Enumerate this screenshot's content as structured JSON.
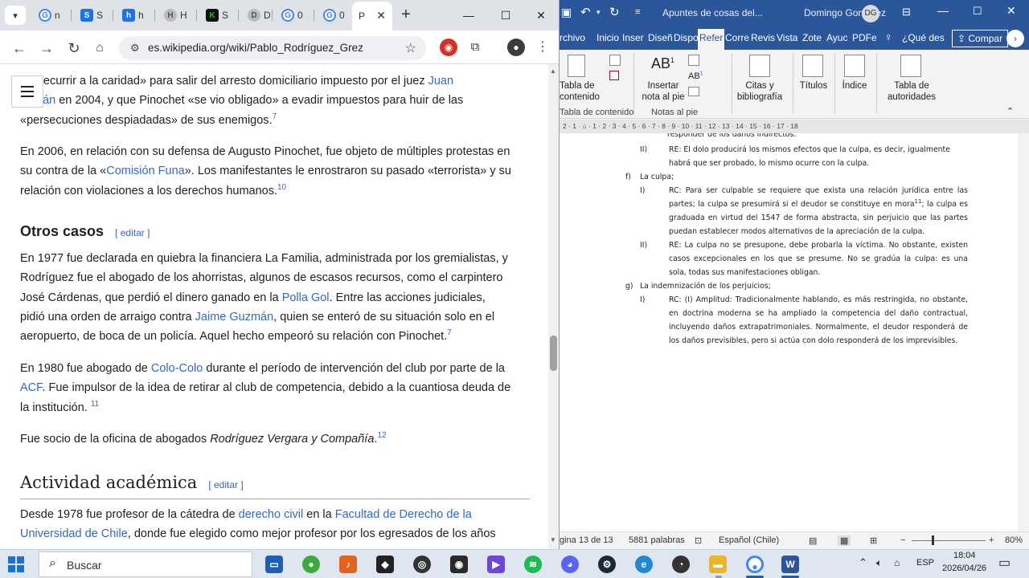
{
  "browser": {
    "tabs": [
      {
        "fav": "G",
        "label": "n",
        "color": "#4285f4"
      },
      {
        "fav": "S",
        "label": "S",
        "color": "#1a73e8"
      },
      {
        "fav": "h",
        "label": "h",
        "color": "#1a73e8"
      },
      {
        "fav": "H",
        "label": "H",
        "color": "#777777"
      },
      {
        "fav": "K",
        "label": "S",
        "color": "#16c60c"
      },
      {
        "fav": "D",
        "label": "D",
        "color": "#777777"
      },
      {
        "fav": "G",
        "label": "0",
        "color": "#4285f4"
      },
      {
        "fav": "G",
        "label": "0",
        "color": "#4285f4"
      }
    ],
    "active_tab": {
      "fav": "W",
      "label": "P"
    },
    "url": "es.wikipedia.org/wiki/Pablo_Rodríguez_Grez"
  },
  "article": {
    "p0": {
      "t0": "«recurrir a la caridad» para salir del arresto domiciliario impuesto por el juez ",
      "l0": "Juan",
      "l1": "mán",
      "t1": " en 2004, y que Pinochet «se vio obligado» a evadir impuestos para huir de las",
      "t2": "«persecuciones despiadadas» de sus enemigos.",
      "s": "7"
    },
    "p1": {
      "t0": "En 2006, en relación con su defensa de Augusto Pinochet, fue objeto de múltiples protestas en",
      "t1": "su contra de la «",
      "l0": "Comisión Funa",
      "t2": "». Los manifestantes le enrostraron su pasado «terrorista» y su",
      "t3": "relación con violaciones a los derechos humanos.",
      "s": "10"
    },
    "h_otros": "Otros casos",
    "edit": "editar",
    "p2": {
      "t0": "En 1977 fue declarada en quiebra la financiera La Familia, administrada por los gremialistas, y",
      "t1": "Rodríguez fue el abogado de los ahorristas, algunos de escasos recursos, como el carpintero",
      "t2": "José Cárdenas, que perdió el dinero ganado en la ",
      "l0": "Polla Gol",
      "t3": ". Entre las acciones judiciales,",
      "t4": "pidió una orden de arraigo contra ",
      "l1": "Jaime Guzmán",
      "t5": ", quien se enteró de su situación solo en el",
      "t6": "aeropuerto, de boca de un policía. Aquel hecho empeoró su relación con Pinochet.",
      "s": "7"
    },
    "p3": {
      "t0": "En 1980 fue abogado de ",
      "l0": "Colo-Colo",
      "t1": " durante el período de intervención del club por parte de la",
      "l1": "ACF",
      "t2": ". Fue impulsor de la idea de retirar al club de competencia, debido a la cuantiosa deuda de",
      "t3": "la institución.",
      "s": "11"
    },
    "p4": {
      "t0": "Fue socio de la oficina de abogados ",
      "i0": "Rodríguez Vergara y Compañía",
      "t1": ".",
      "s": "12"
    },
    "h_academica": "Actividad académica",
    "p5": {
      "t0": "Desde 1978 fue profesor de la cátedra de ",
      "l0": "derecho civil",
      "t1": " en la ",
      "l1": "Facultad de Derecho de la",
      "l2": "Universidad de Chile",
      "t2": ", donde fue elegido como mejor profesor por los egresados de los años"
    }
  },
  "word": {
    "doc_title": "Apuntes de cosas del...",
    "user": "Domingo Gonzalez",
    "user_initials": "DG",
    "tabs": [
      "rchivo",
      "Inicio",
      "Inser",
      "Diseñ",
      "Dispo",
      "Refer",
      "Corre",
      "Revis",
      "Vista",
      "Zote",
      "Ayuc",
      "PDFe"
    ],
    "tell_me": "¿Qué des",
    "share": "Compar",
    "ribbon": {
      "toc": "Tabla de\ncontenido",
      "toc_group": "Tabla de contenido",
      "footnote": "Insertar\nnota al pie",
      "footnote_group": "Notas al pie",
      "citations": "Citas y\nbibliografía",
      "captions": "Títulos",
      "index": "Índice",
      "authorities": "Tabla de\nautoridades"
    },
    "doc": {
      "top_cut": "responder de los daños indirectos.",
      "e2_num": "II)",
      "e2_l1": "RE: El dolo producirá los mismos efectos que la culpa, es decir, igualmente",
      "e2_l2": "habrá que ser probado, lo mismo ocurre con la culpa.",
      "f_letter": "f)",
      "f_title": "La culpa;",
      "f1_num": "I)",
      "f1_text": "RC: Para ser culpable se requiere que exista una relación jurídica entre las partes; la culpa se presumirá si el deudor se constituye en mora",
      "f1_sup": "11",
      "f1_text2": "; la culpa es graduada en virtud del 1547 de forma abstracta, sin perjuicio que las partes puedan establecer modos alternativos de la apreciación de la culpa.",
      "f2_num": "II)",
      "f2_text": "RE: La culpa no se presupone, debe probarla la víctima. No obstante, existen casos excepcionales en los que se presume. No se gradúa la culpa: es una sola, todas sus manifestaciones obligan.",
      "g_letter": "g)",
      "g_title": "La indemnización de los perjuicios;",
      "g1_num": "I)",
      "g1_text": "RC: (I) Amplitud: Tradicionalmente hablando, es más restringida, no obstante, en doctrina moderna se ha ampliado la competencia del daño contractual, incluyendo daños extrapatrimoniales. Normalmente, el deudor responderá de los daños previsibles, pero si actúa con dolo responderá de los imprevisibles."
    },
    "status": {
      "page": "gina 13 de 13",
      "words": "5881 palabras",
      "lang": "Español (Chile)",
      "zoom": "80%"
    }
  },
  "taskbar": {
    "search": "Buscar",
    "lang": "ESP",
    "time": "18:04",
    "date": "2026/04/26"
  }
}
